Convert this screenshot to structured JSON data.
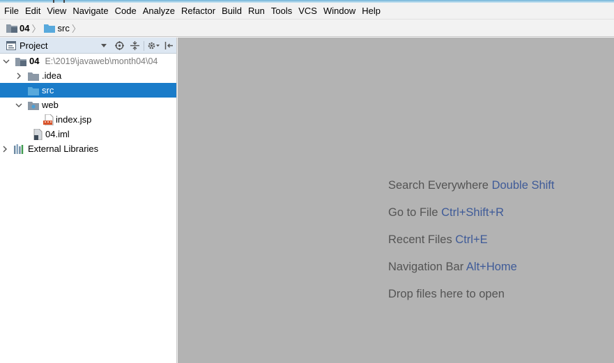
{
  "menubar": {
    "items": [
      {
        "label": "File"
      },
      {
        "label": "Edit"
      },
      {
        "label": "View"
      },
      {
        "label": "Navigate"
      },
      {
        "label": "Code"
      },
      {
        "label": "Analyze"
      },
      {
        "label": "Refactor"
      },
      {
        "label": "Build"
      },
      {
        "label": "Run"
      },
      {
        "label": "Tools"
      },
      {
        "label": "VCS"
      },
      {
        "label": "Window"
      },
      {
        "label": "Help"
      }
    ]
  },
  "breadcrumb": {
    "items": [
      {
        "label": "04",
        "icon": "project-folder-icon"
      },
      {
        "label": "src",
        "icon": "source-folder-icon"
      }
    ]
  },
  "project_panel": {
    "title": "Project",
    "tree": [
      {
        "label": "04",
        "path": "E:\\2019\\javaweb\\month04\\04",
        "expanded": true,
        "icon": "project-folder-icon"
      },
      {
        "label": ".idea",
        "expanded": false,
        "icon": "folder-icon"
      },
      {
        "label": "src",
        "selected": true,
        "icon": "source-folder-icon"
      },
      {
        "label": "web",
        "expanded": true,
        "icon": "web-folder-icon"
      },
      {
        "label": "index.jsp",
        "icon": "jsp-file-icon"
      },
      {
        "label": "04.iml",
        "icon": "iml-file-icon"
      },
      {
        "label": "External Libraries",
        "expanded": false,
        "icon": "libraries-icon"
      }
    ]
  },
  "editor": {
    "hints": [
      {
        "text": "Search Everywhere",
        "shortcut": "Double Shift"
      },
      {
        "text": "Go to File",
        "shortcut": "Ctrl+Shift+R"
      },
      {
        "text": "Recent Files",
        "shortcut": "Ctrl+E"
      },
      {
        "text": "Navigation Bar",
        "shortcut": "Alt+Home"
      },
      {
        "text": "Drop files here to open",
        "shortcut": ""
      }
    ]
  },
  "colors": {
    "selection": "#1a7cc9",
    "shortcut": "#3f5b98",
    "editor_background": "#b3b3b3",
    "panel_header": "#dde7f2"
  }
}
